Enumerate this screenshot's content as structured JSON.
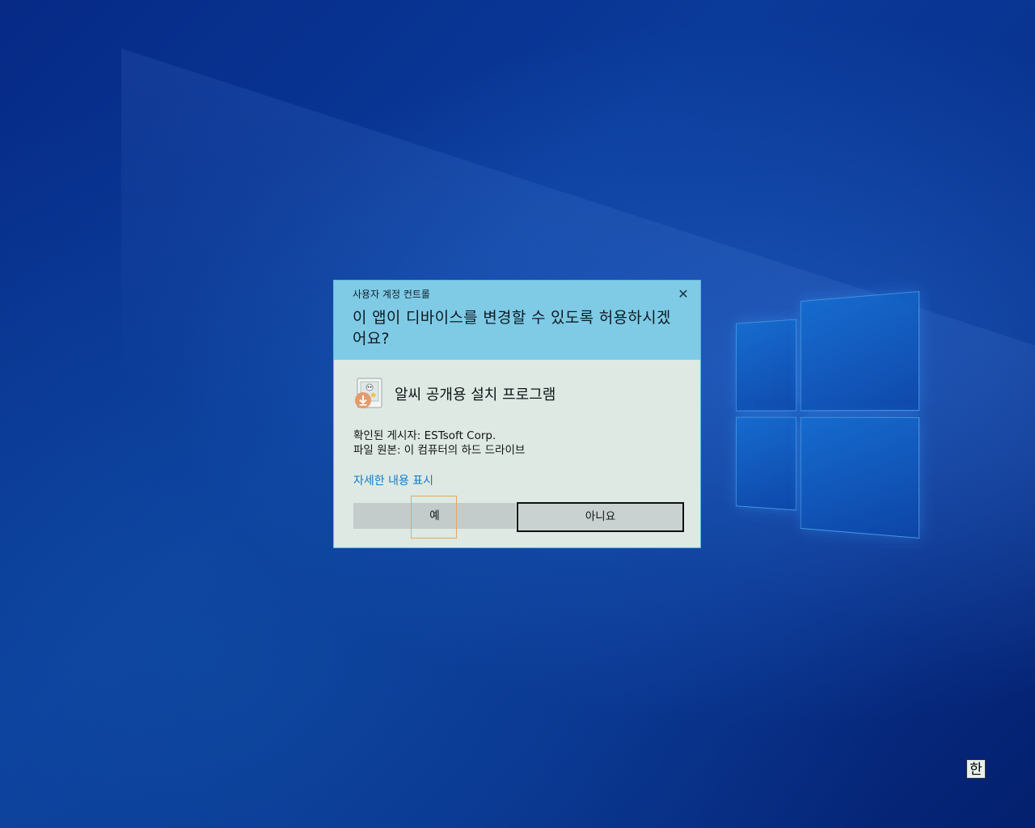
{
  "dialog": {
    "caption": "사용자 계정 컨트롤",
    "close_glyph": "✕",
    "question": "이 앱이 디바이스를 변경할 수 있도록 허용하시겠어요?",
    "app_name": "알씨 공개용 설치 프로그램",
    "publisher_line": "확인된 게시자: ESTsoft Corp.",
    "origin_line": "파일 원본: 이 컴퓨터의 하드 드라이브",
    "details_link": "자세한 내용 표시",
    "yes_label": "예",
    "no_label": "아니요"
  },
  "taskbar": {
    "ime_indicator": "한"
  },
  "icons": {
    "app": "installer-icon",
    "close": "close-icon"
  },
  "colors": {
    "header_bg": "#7fcbe6",
    "body_bg": "#dde9e2",
    "link": "#1779c4",
    "focus_ring": "#e4a862"
  }
}
